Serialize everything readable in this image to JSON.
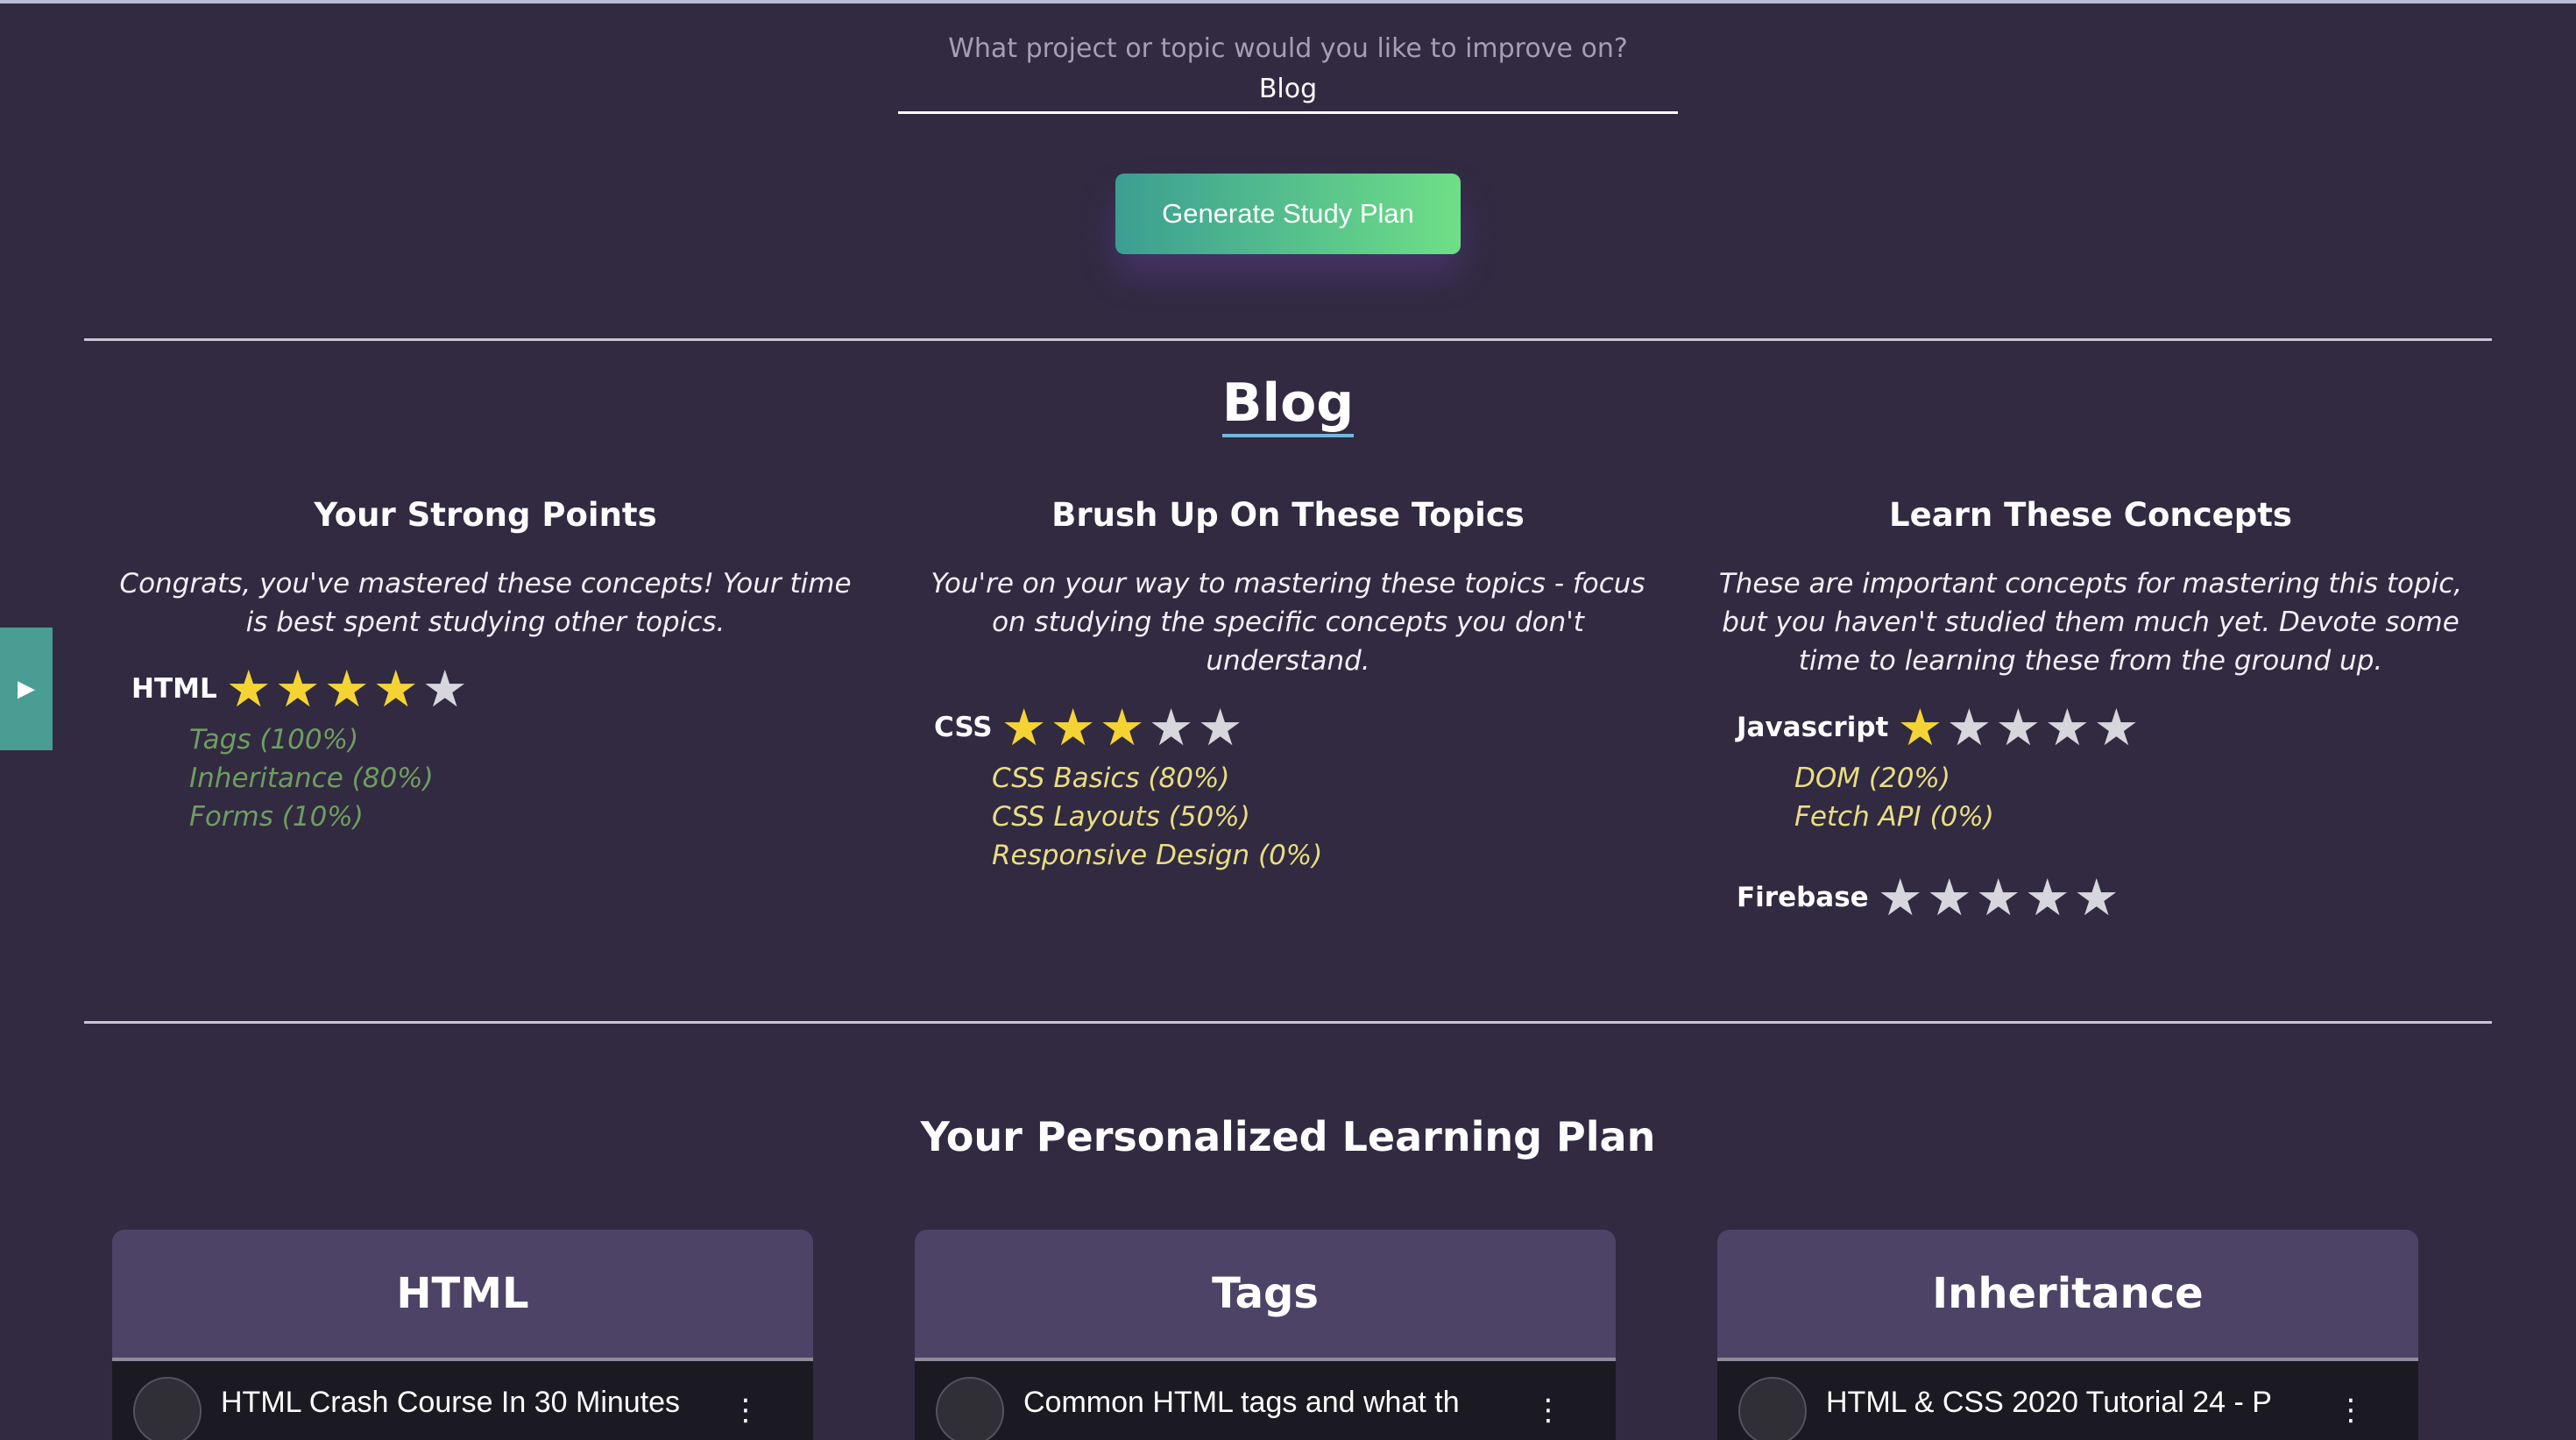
{
  "search": {
    "prompt": "What project or topic would you like to improve on?",
    "value": "Blog"
  },
  "generate_button": "Generate Study Plan",
  "topic": "Blog",
  "columns": {
    "strong": {
      "title": "Your Strong Points",
      "desc": "Congrats, you've mastered these concepts! Your time is best spent studying other topics.",
      "skills": [
        {
          "name": "HTML",
          "rating": 4,
          "concepts": [
            "Tags (100%)",
            "Inheritance (80%)",
            "Forms (10%)"
          ]
        }
      ]
    },
    "brush": {
      "title": "Brush Up On These Topics",
      "desc": "You're on your way to mastering these topics - focus on studying the specific concepts you don't understand.",
      "skills": [
        {
          "name": "CSS",
          "rating": 3,
          "concepts": [
            "CSS Basics (80%)",
            "CSS Layouts (50%)",
            "Responsive Design (0%)"
          ]
        }
      ]
    },
    "learn": {
      "title": "Learn These Concepts",
      "desc": "These are important concepts for mastering this topic, but you haven't studied them much yet. Devote some time to learning these from the ground up.",
      "skills": [
        {
          "name": "Javascript",
          "rating": 1,
          "concepts": [
            "DOM (20%)",
            "Fetch API (0%)"
          ]
        },
        {
          "name": "Firebase",
          "rating": 0,
          "concepts": []
        }
      ]
    }
  },
  "plan_title": "Your Personalized Learning Plan",
  "cards": [
    {
      "title": "HTML",
      "video_title": "HTML Crash Course In 30 Minutes"
    },
    {
      "title": "Tags",
      "video_title": "Common HTML tags and what th"
    },
    {
      "title": "Inheritance",
      "video_title": "HTML & CSS 2020 Tutorial 24 - P"
    }
  ],
  "icons": {
    "star": "★",
    "side_tab": "play-triangle",
    "video_menu": "vertical-dots"
  },
  "colors": {
    "background": "#312a41",
    "star_on": "#f4d435",
    "star_off": "#d6d6dc",
    "strong_concepts": "#6f9d60",
    "brush_concepts": "#e9dd83",
    "button_start": "#3b9e92",
    "button_end": "#6edf87",
    "card": "#4c4366"
  }
}
